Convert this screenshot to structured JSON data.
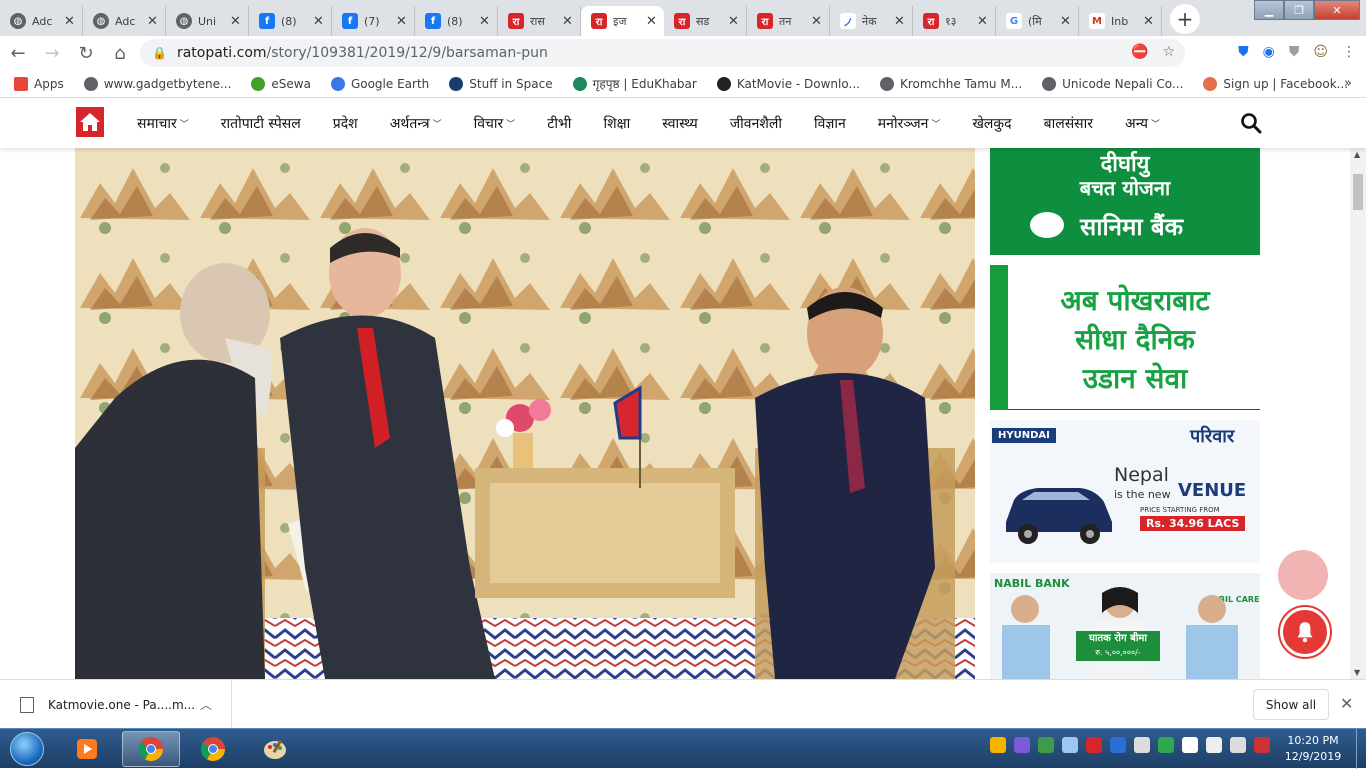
{
  "tabs": [
    {
      "title": "Adc",
      "favicon": "globe-icon",
      "active": false
    },
    {
      "title": "Adc",
      "favicon": "globe-icon",
      "active": false
    },
    {
      "title": "Uni",
      "favicon": "globe-icon",
      "active": false
    },
    {
      "title": "(8)",
      "favicon": "facebook-icon",
      "active": false
    },
    {
      "title": "(7)",
      "favicon": "facebook-icon",
      "active": false
    },
    {
      "title": "(8)",
      "favicon": "facebook-icon",
      "active": false
    },
    {
      "title": "रास",
      "favicon": "ratopati-icon",
      "active": false
    },
    {
      "title": "इज",
      "favicon": "ratopati-icon",
      "active": true
    },
    {
      "title": "सड",
      "favicon": "ratopati-icon",
      "active": false
    },
    {
      "title": "तन",
      "favicon": "ratopati-icon",
      "active": false
    },
    {
      "title": "नेक",
      "favicon": "feather-icon",
      "active": false
    },
    {
      "title": "१३",
      "favicon": "ratopati-icon",
      "active": false
    },
    {
      "title": "(मि",
      "favicon": "google-icon",
      "active": false
    },
    {
      "title": "Inb",
      "favicon": "gmail-icon",
      "active": false
    }
  ],
  "address": {
    "host": "ratopati.com",
    "path": "/story/109381/2019/12/9/barsaman-pun"
  },
  "bookmarks": [
    {
      "label": "Apps",
      "color": "#e8453c"
    },
    {
      "label": "www.gadgetbytene...",
      "color": "#5f6368"
    },
    {
      "label": "eSewa",
      "color": "#41a124"
    },
    {
      "label": "Google Earth",
      "color": "#3b78e7"
    },
    {
      "label": "Stuff in Space",
      "color": "#1a3d6b"
    },
    {
      "label": "गृहपृष्ठ | EduKhabar",
      "color": "#1d8a5e"
    },
    {
      "label": "KatMovie - Downlo...",
      "color": "#222222"
    },
    {
      "label": "Kromchhe Tamu M...",
      "color": "#5f6368"
    },
    {
      "label": "Unicode Nepali Co...",
      "color": "#5f6368"
    },
    {
      "label": "Sign up | Facebook...",
      "color": "#e46f4a"
    }
  ],
  "site_menu": [
    {
      "label": "समाचार",
      "dropdown": true
    },
    {
      "label": "रातोपाटी स्पेसल",
      "dropdown": false
    },
    {
      "label": "प्रदेश",
      "dropdown": false
    },
    {
      "label": "अर्थतन्त्र",
      "dropdown": true
    },
    {
      "label": "विचार",
      "dropdown": true
    },
    {
      "label": "टीभी",
      "dropdown": false
    },
    {
      "label": "शिक्षा",
      "dropdown": false
    },
    {
      "label": "स्वास्थ्य",
      "dropdown": false
    },
    {
      "label": "जीवनशैली",
      "dropdown": false
    },
    {
      "label": "विज्ञान",
      "dropdown": false
    },
    {
      "label": "मनोरञ्जन",
      "dropdown": true
    },
    {
      "label": "खेलकुद",
      "dropdown": false
    },
    {
      "label": "बालसंसार",
      "dropdown": false
    },
    {
      "label": "अन्य",
      "dropdown": true
    }
  ],
  "ads": {
    "sanima": {
      "line1": "दीर्घायु",
      "line2": "बचत योजना",
      "brand": "सानिमा बैंक"
    },
    "pokhara": {
      "line1": "अब पोखराबाट",
      "line2": "सीधा दैनिक",
      "line3": "उडान सेवा"
    },
    "hyundai": {
      "brand": "HYUNDAI",
      "pariwar": "परिवार",
      "line1": "Nepal",
      "line2": "is the new",
      "model": "VENUE",
      "price_label": "PRICE STARTING FROM",
      "price": "Rs. 34.96 LACS"
    },
    "nabil": {
      "brand": "NABIL BANK",
      "care": "NABIL CARE",
      "sign_line1": "घातक रोग बीमा",
      "sign_line2": "रु. ५,००,०००/-"
    }
  },
  "download": {
    "filename": "Katmovie.one - Pa....m...",
    "show_all": "Show all"
  },
  "clock": {
    "time": "10:20 PM",
    "date": "12/9/2019"
  },
  "colors": {
    "brand_red": "#d6262b",
    "sanima_green": "#0e8f3f",
    "tab_bg": "#dee1e6",
    "taskbar": "#1d3f66"
  }
}
